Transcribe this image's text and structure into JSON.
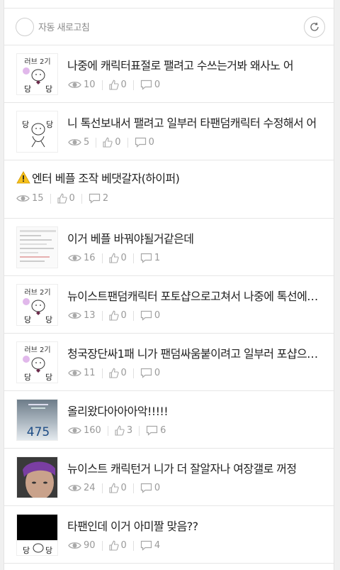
{
  "toolbar": {
    "auto_refresh_label": "자동 새로고침"
  },
  "posts": [
    {
      "title": "나중에 캐릭터표절로 팰려고 수쓰는거봐 왜사노 어",
      "views": "10",
      "likes": "0",
      "comments": "0",
      "thumb": "sticker-love2",
      "thumb_text": [
        "러브 2기",
        "당",
        "당"
      ]
    },
    {
      "title": "니 톡선보내서 팰려고 일부러 타팬덤캐릭터 수정해서 어",
      "views": "5",
      "likes": "0",
      "comments": "0",
      "thumb": "sticker-dang",
      "thumb_text": [
        "당",
        "당"
      ]
    },
    {
      "title": "엔터 베플 조작 베댓갈자(하이퍼)",
      "views": "15",
      "likes": "0",
      "comments": "2",
      "thumb": "none",
      "warning_icon": "warning-icon"
    },
    {
      "title": "이거 베플 바꿔야될거같은데",
      "views": "16",
      "likes": "0",
      "comments": "1",
      "thumb": "screenshot"
    },
    {
      "title": "뉴이스트팬덤캐릭터 포토샵으로고쳐서 나중에 톡선에서…",
      "views": "13",
      "likes": "0",
      "comments": "0",
      "thumb": "sticker-love2",
      "thumb_text": [
        "러브 2기",
        "당",
        "당"
      ]
    },
    {
      "title": "청국장단싸1패 니가 팬덤싸움붙이려고 일부러 포샵으로…",
      "views": "11",
      "likes": "0",
      "comments": "0",
      "thumb": "sticker-love2",
      "thumb_text": [
        "러브 2기",
        "당",
        "당"
      ]
    },
    {
      "title": "올리왔다아아아악!!!!!",
      "views": "160",
      "likes": "3",
      "comments": "6",
      "thumb": "phone-photo",
      "thumb_text": [
        "475"
      ]
    },
    {
      "title": "뉴이스트 캐릭턴거 니가 더 잘알자나 여장갤로 꺼정",
      "views": "24",
      "likes": "0",
      "comments": "0",
      "thumb": "face-photo"
    },
    {
      "title": "타팬인데 이거 아미짤 맞음??",
      "views": "90",
      "likes": "0",
      "comments": "4",
      "thumb": "black-sticker",
      "thumb_text": [
        "당",
        "당"
      ]
    }
  ]
}
